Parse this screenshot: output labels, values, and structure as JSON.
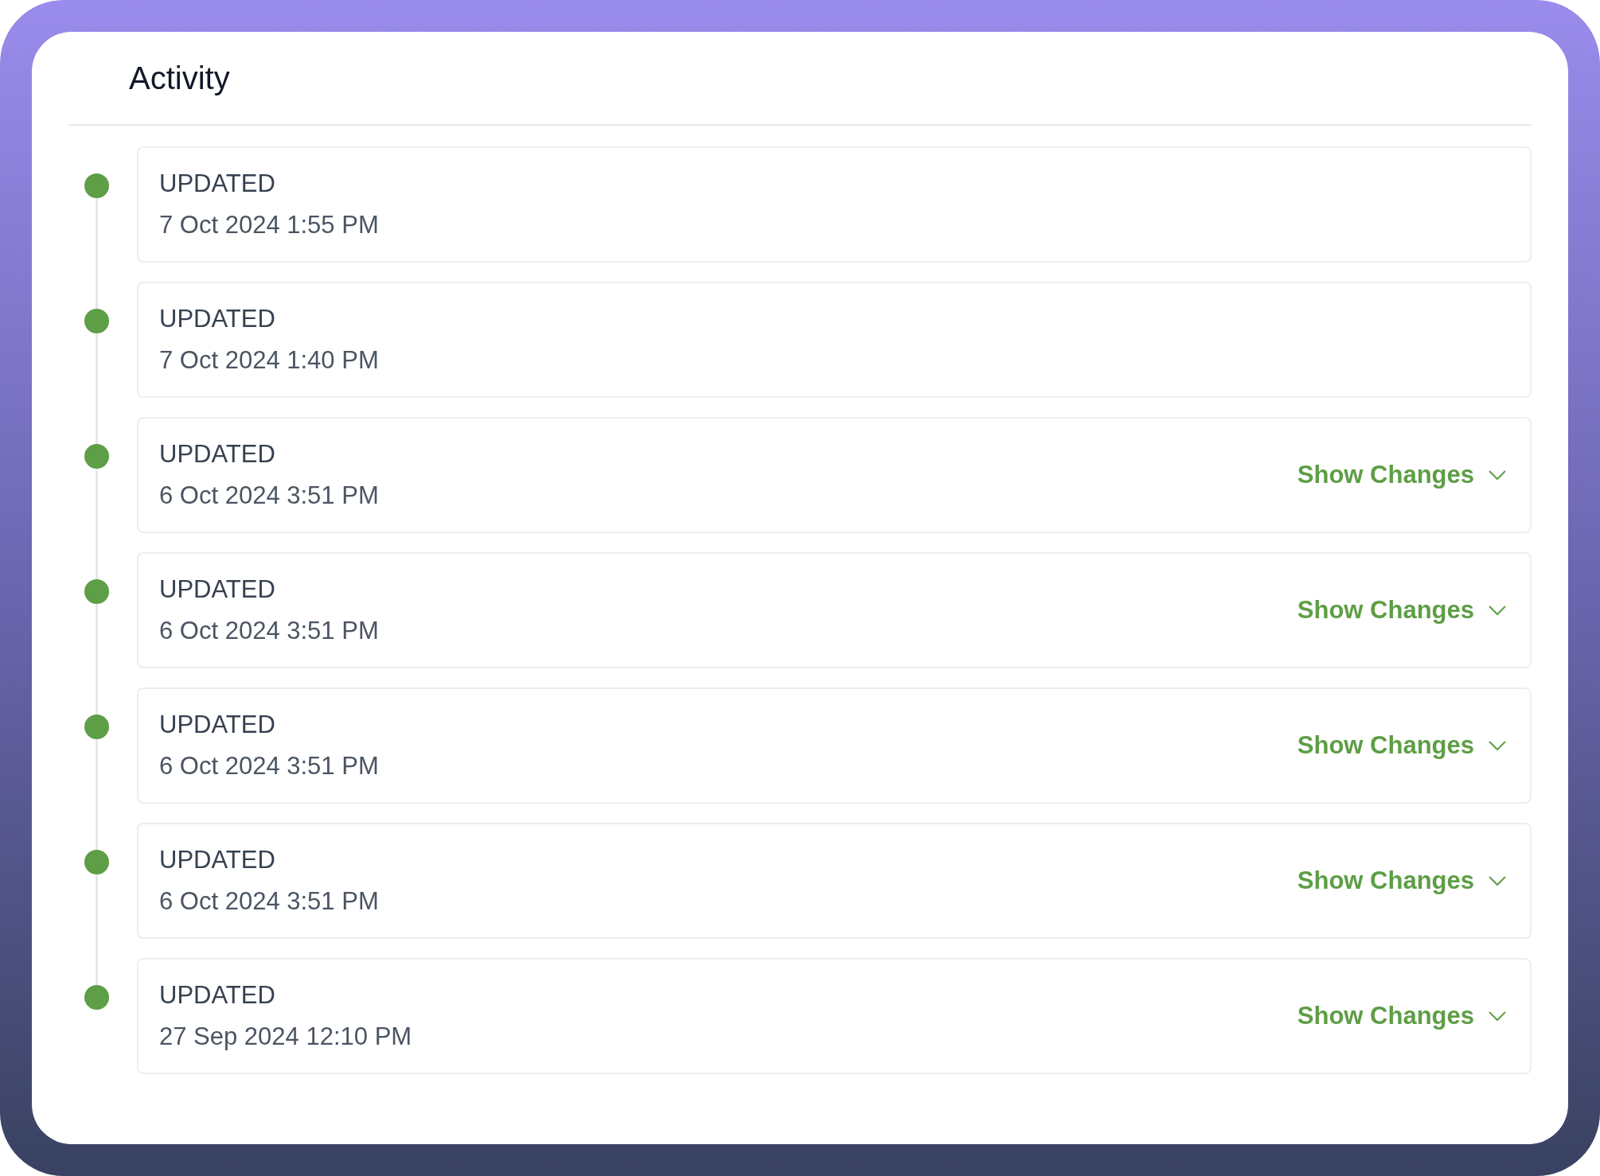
{
  "title": "Activity",
  "events": [
    {
      "status": "UPDATED",
      "date": "7 Oct 2024 1:55 PM",
      "color": "#5e9e46"
    },
    {
      "status": "UPDATED",
      "date": "7 Oct 2024 1:40 PM",
      "color": "#5e9e46"
    },
    {
      "status": "UPDATED",
      "date": "6 Oct 2024 3:51 PM",
      "color": "#5e9e46",
      "action": "Show Changes"
    },
    {
      "status": "UPDATED",
      "date": "6 Oct 2024 3:51 PM",
      "color": "#5e9e46",
      "action": "Show Changes"
    },
    {
      "status": "UPDATED",
      "date": "6 Oct 2024 3:51 PM",
      "color": "#5e9e46",
      "action": "Show Changes"
    },
    {
      "status": "UPDATED",
      "date": "6 Oct 2024 3:51 PM",
      "color": "#5e9e46",
      "action": "Show Changes"
    },
    {
      "status": "UPDATED",
      "date": "27 Sep 2024 12:10 PM",
      "color": "#5e9e46",
      "action": "Show Changes"
    }
  ]
}
